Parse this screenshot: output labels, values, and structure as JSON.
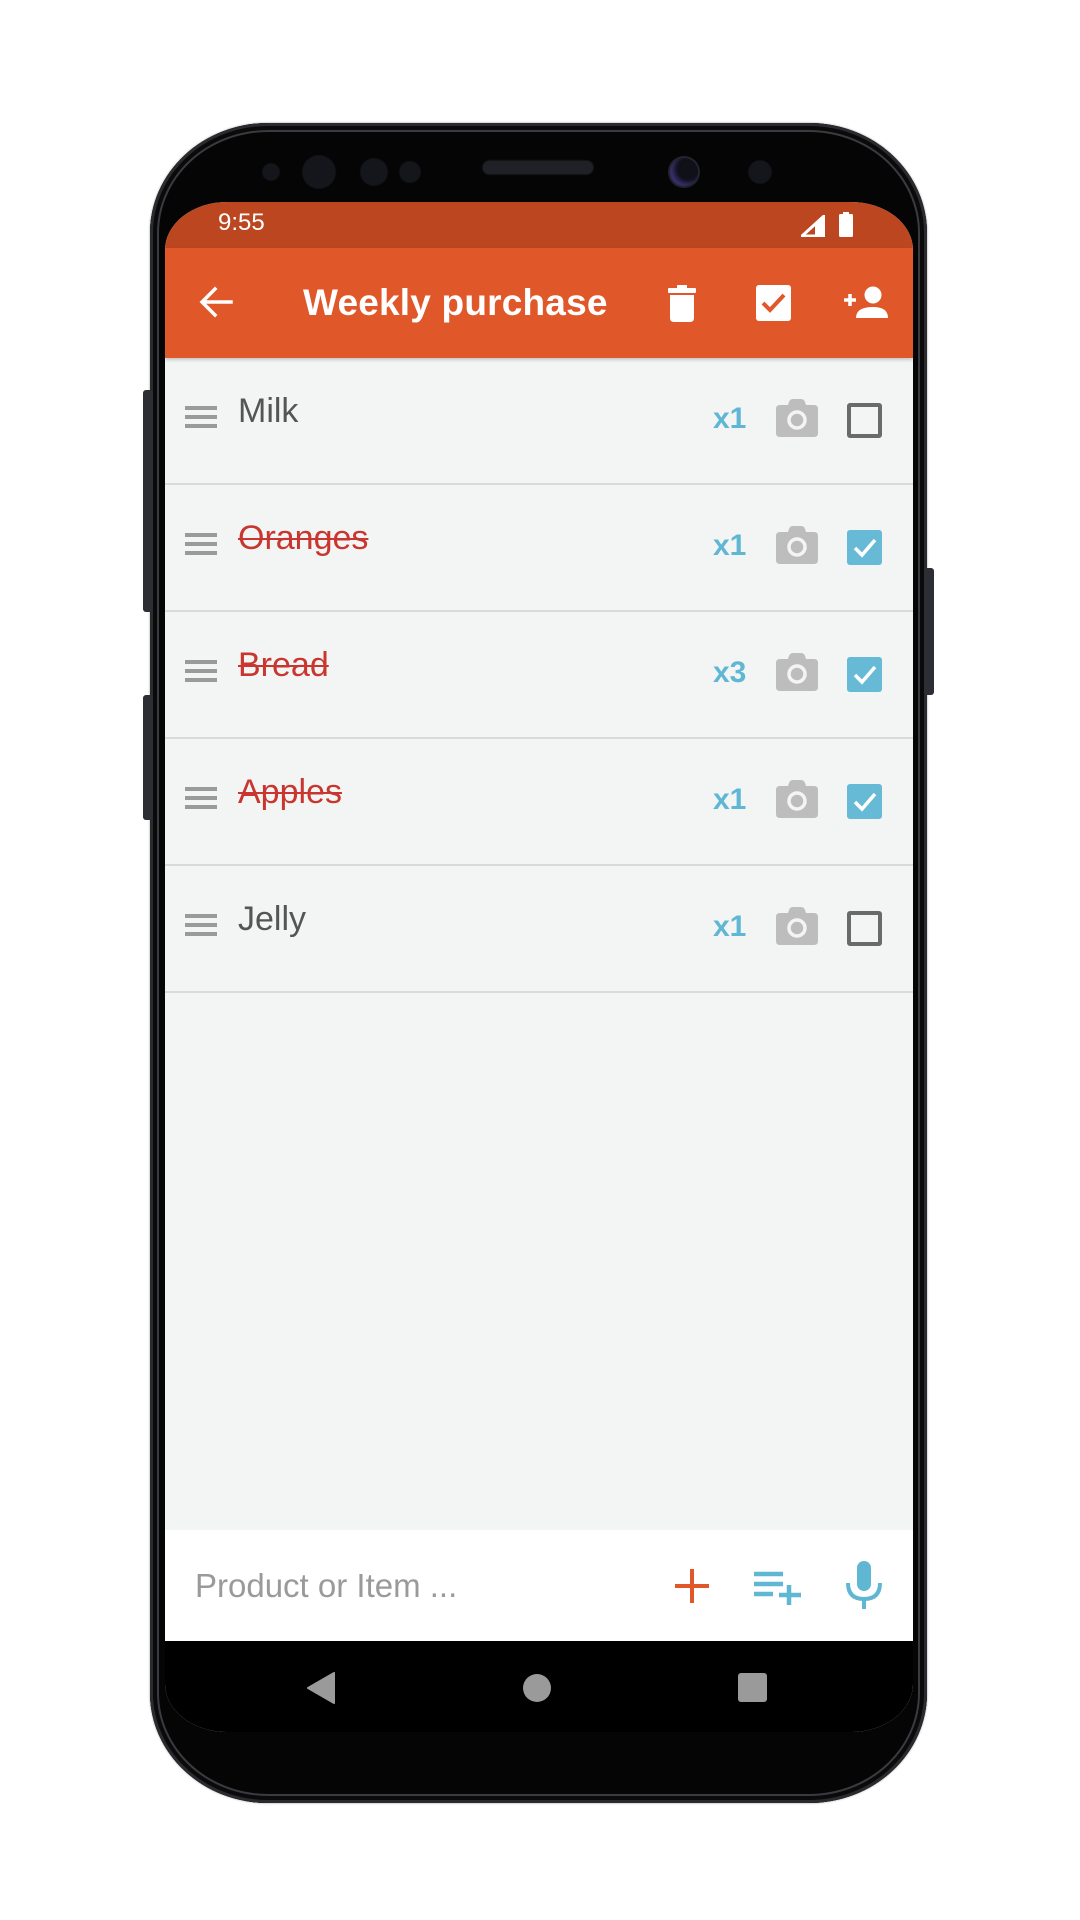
{
  "status_bar": {
    "time": "9:55",
    "icons": [
      "signal-icon",
      "battery-icon"
    ]
  },
  "app_bar": {
    "title": "Weekly purchase",
    "back_icon": "arrow-back-icon",
    "actions": [
      {
        "name": "delete",
        "icon": "trash-icon"
      },
      {
        "name": "check-all",
        "icon": "checkbox-checked-icon"
      },
      {
        "name": "share-add-person",
        "icon": "person-add-icon"
      }
    ]
  },
  "items": [
    {
      "name": "Milk",
      "quantity": "x1",
      "checked": false
    },
    {
      "name": "Oranges",
      "quantity": "x1",
      "checked": true
    },
    {
      "name": "Bread",
      "quantity": "x3",
      "checked": true
    },
    {
      "name": "Apples",
      "quantity": "x1",
      "checked": true
    },
    {
      "name": "Jelly",
      "quantity": "x1",
      "checked": false
    }
  ],
  "input_bar": {
    "placeholder": "Product or Item ...",
    "value": "",
    "add_icon": "plus-icon",
    "add_list_icon": "playlist-add-icon",
    "voice_icon": "microphone-icon"
  },
  "nav_bar": {
    "back": "nav-back-icon",
    "home": "nav-home-icon",
    "recents": "nav-recents-icon"
  },
  "colors": {
    "status_bar": "#bb4620",
    "app_bar": "#e0572a",
    "accent_blue": "#67bad5",
    "done_text": "#c8362f",
    "background": "#f3f4f4"
  }
}
